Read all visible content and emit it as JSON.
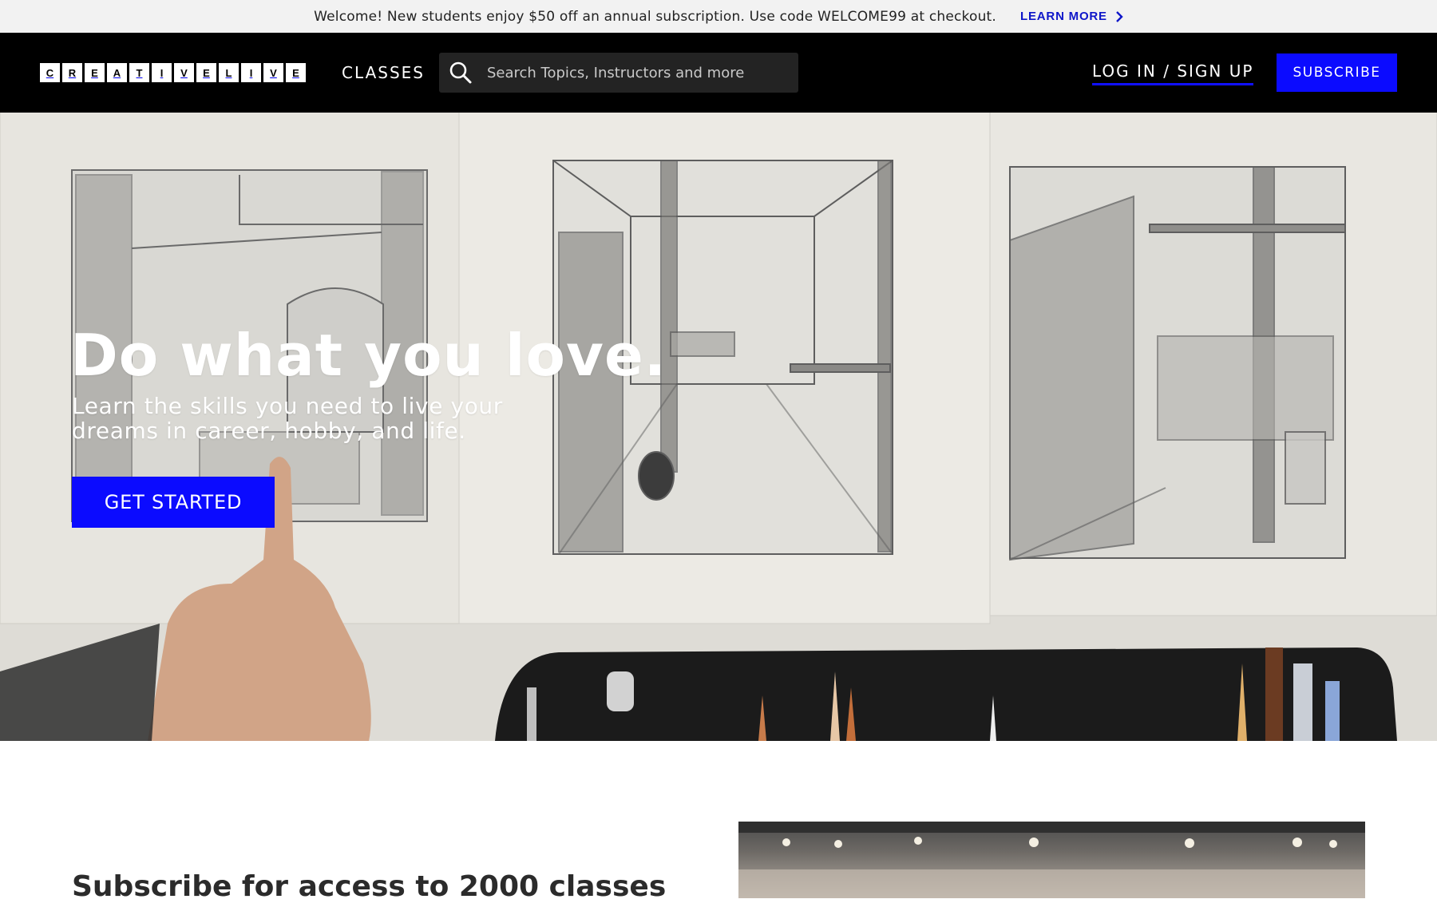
{
  "promo": {
    "text": "Welcome! New students enjoy $50 off an annual subscription. Use code WELCOME99 at checkout.",
    "link_label": "LEARN MORE",
    "link_icon": "chevron-right-icon"
  },
  "nav": {
    "logo_letters": [
      "C",
      "R",
      "E",
      "A",
      "T",
      "I",
      "V",
      "E",
      "L",
      "I",
      "V",
      "E"
    ],
    "classes_label": "CLASSES",
    "search_placeholder": "Search Topics, Instructors and more",
    "search_icon": "search-icon",
    "login_label": "LOG IN / SIGN UP",
    "subscribe_label": "SUBSCRIBE"
  },
  "hero": {
    "title": "Do what you love.",
    "subtitle": "Learn the skills you need to live your dreams in career, hobby, and life.",
    "cta_label": "GET STARTED"
  },
  "lower": {
    "heading": "Subscribe for access to 2000 classes"
  },
  "colors": {
    "accent_blue": "#0b0bff",
    "link_blue": "#0e16c9",
    "nav_bg": "#000000",
    "promo_bg": "#f2f2f2"
  }
}
